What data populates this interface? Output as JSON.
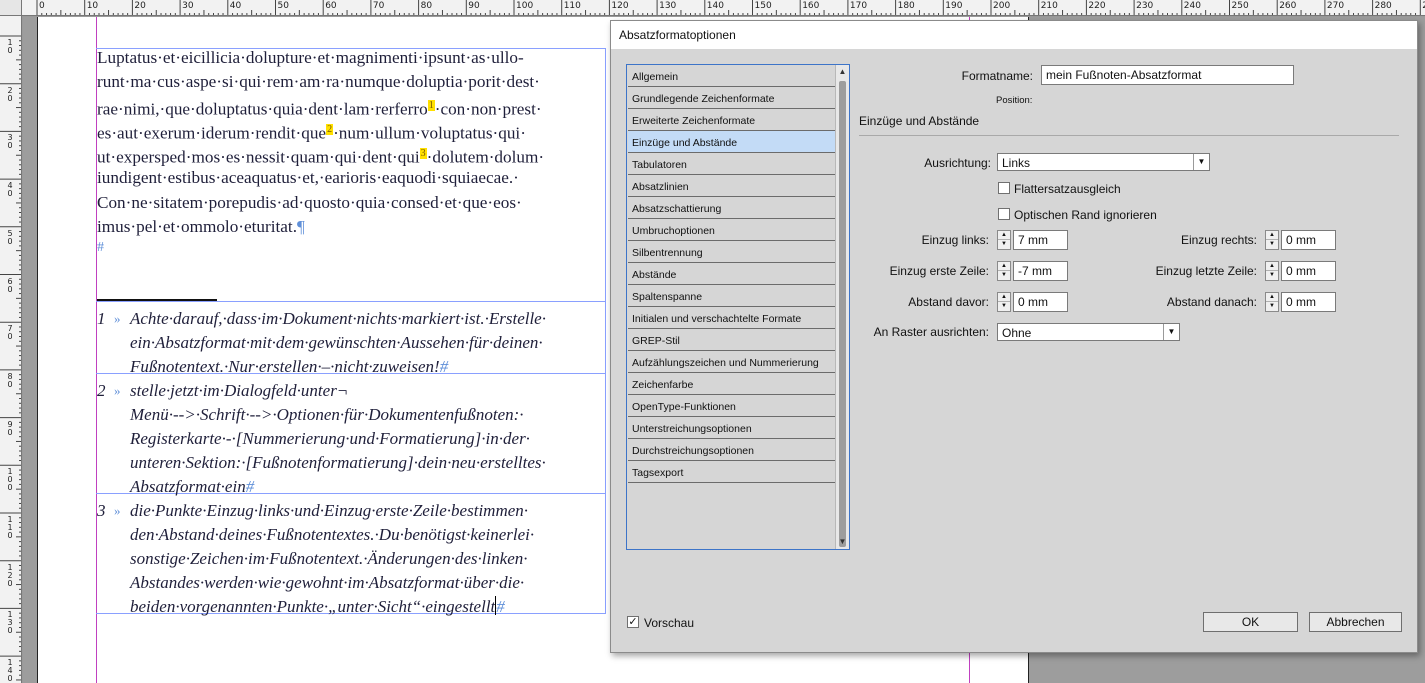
{
  "ruler": {
    "top_labels": [
      "0",
      "10",
      "20",
      "30",
      "40",
      "50",
      "60",
      "70",
      "80",
      "90",
      "100",
      "110",
      "120",
      "130",
      "140",
      "150",
      "160",
      "170",
      "180",
      "190",
      "200",
      "210",
      "220",
      "230",
      "240",
      "250",
      "260",
      "270",
      "280",
      "290"
    ],
    "left_labels": [
      "10",
      "20",
      "30",
      "40",
      "50",
      "60",
      "70",
      "80",
      "90",
      "100",
      "110",
      "120",
      "130",
      "140"
    ]
  },
  "document": {
    "body_lines": [
      "Luptatus·et·eicillicia·dolupture·et·magnimenti·ipsunt·as·ullo-",
      "runt·ma·cus·aspe·si·qui·rem·am·ra·numque·doluptia·porit·dest·",
      "rae·nimi,·que·doluptatus·quia·dent·lam·rerferro",
      "es·aut·exerum·iderum·rendit·que",
      "ut·expersped·mos·es·nessit·quam·qui·dent·qui",
      "iundigent·estibus·aceaquatus·et,·earioris·eaquodi·squiaecae.·",
      "Con·ne·sitatem·porepudis·ad·quosto·quia·consed·et·que·eos·",
      "imus·pel·et·ommolo·eturitat."
    ],
    "line3_after": "·con·non·prest·",
    "line4_after": "·num·ullum·voluptatus·qui·",
    "line5_after": "·dolutem·dolum·",
    "fn_refs": [
      "1",
      "2",
      "3"
    ],
    "pilcrow": "¶",
    "hash": "#",
    "footnotes": [
      {
        "number": "1",
        "tab": "»",
        "lines": [
          "Achte·darauf,·dass·im·Dokument·nichts·markiert·ist.·Erstelle·",
          "ein·Absatzformat·mit·dem·gewünschten·Aussehen·für·deinen·",
          "Fußnotentext.·Nur·erstellen·–·nicht·zuweisen!"
        ]
      },
      {
        "number": "2",
        "tab": "»",
        "lines": [
          "stelle·jetzt·im·Dialogfeld·unter¬",
          "Menü·-->·Schrift·-->·Optionen·für·Dokumentenfußnoten:·",
          "Registerkarte·-·[Nummerierung·und·Formatierung]·in·der·",
          "unteren·Sektion:·[Fußnotenformatierung]·dein·neu·erstelltes·",
          "Absatzformat·ein"
        ]
      },
      {
        "number": "3",
        "tab": "»",
        "lines": [
          "die·Punkte·Einzug·links·und·Einzug·erste·Zeile·bestimmen·",
          "den·Abstand·deines·Fußnotentextes.·Du·benötigst·keinerlei·",
          "sonstige·Zeichen·im·Fußnotentext.·Änderungen·des·linken·",
          "Abstandes·werden·wie·gewohnt·im·Absatzformat·über·die·",
          "beiden·vorgenannten·Punkte·„unter·Sicht“·eingestellt"
        ]
      }
    ]
  },
  "dialog": {
    "title": "Absatzformatoptionen",
    "categories": [
      "Allgemein",
      "Grundlegende Zeichenformate",
      "Erweiterte Zeichenformate",
      "Einzüge und Abstände",
      "Tabulatoren",
      "Absatzlinien",
      "Absatzschattierung",
      "Umbruchoptionen",
      "Silbentrennung",
      "Abstände",
      "Spaltenspanne",
      "Initialen und verschachtelte Formate",
      "GREP-Stil",
      "Aufzählungszeichen und Nummerierung",
      "Zeichenfarbe",
      "OpenType-Funktionen",
      "Unterstreichungsoptionen",
      "Durchstreichungsoptionen",
      "Tagsexport"
    ],
    "selected_index": 3,
    "format_name_label": "Formatname:",
    "format_name_value": "mein Fußnoten-Absatzformat",
    "position_label": "Position:",
    "section_title": "Einzüge und Abstände",
    "alignment_label": "Ausrichtung:",
    "alignment_value": "Links",
    "flattersatz_label": "Flattersatzausgleich",
    "optischer_rand_label": "Optischen Rand ignorieren",
    "einzug_links_label": "Einzug links:",
    "einzug_links_value": "7 mm",
    "einzug_rechts_label": "Einzug rechts:",
    "einzug_rechts_value": "0 mm",
    "einzug_erste_label": "Einzug erste Zeile:",
    "einzug_erste_value": "-7 mm",
    "einzug_letzte_label": "Einzug letzte Zeile:",
    "einzug_letzte_value": "0 mm",
    "abstand_davor_label": "Abstand davor:",
    "abstand_davor_value": "0 mm",
    "abstand_danach_label": "Abstand danach:",
    "abstand_danach_value": "0 mm",
    "raster_label": "An Raster ausrichten:",
    "raster_value": "Ohne",
    "preview_label": "Vorschau",
    "preview_checked": true,
    "ok_label": "OK",
    "cancel_label": "Abbrechen"
  },
  "colors": {
    "selection": "#c3dbf6",
    "list_border": "#3d74c8",
    "footnote_marker": "#ffe000",
    "hidden_chars": "#5f8fd8",
    "margin_guide": "#c040c0"
  }
}
